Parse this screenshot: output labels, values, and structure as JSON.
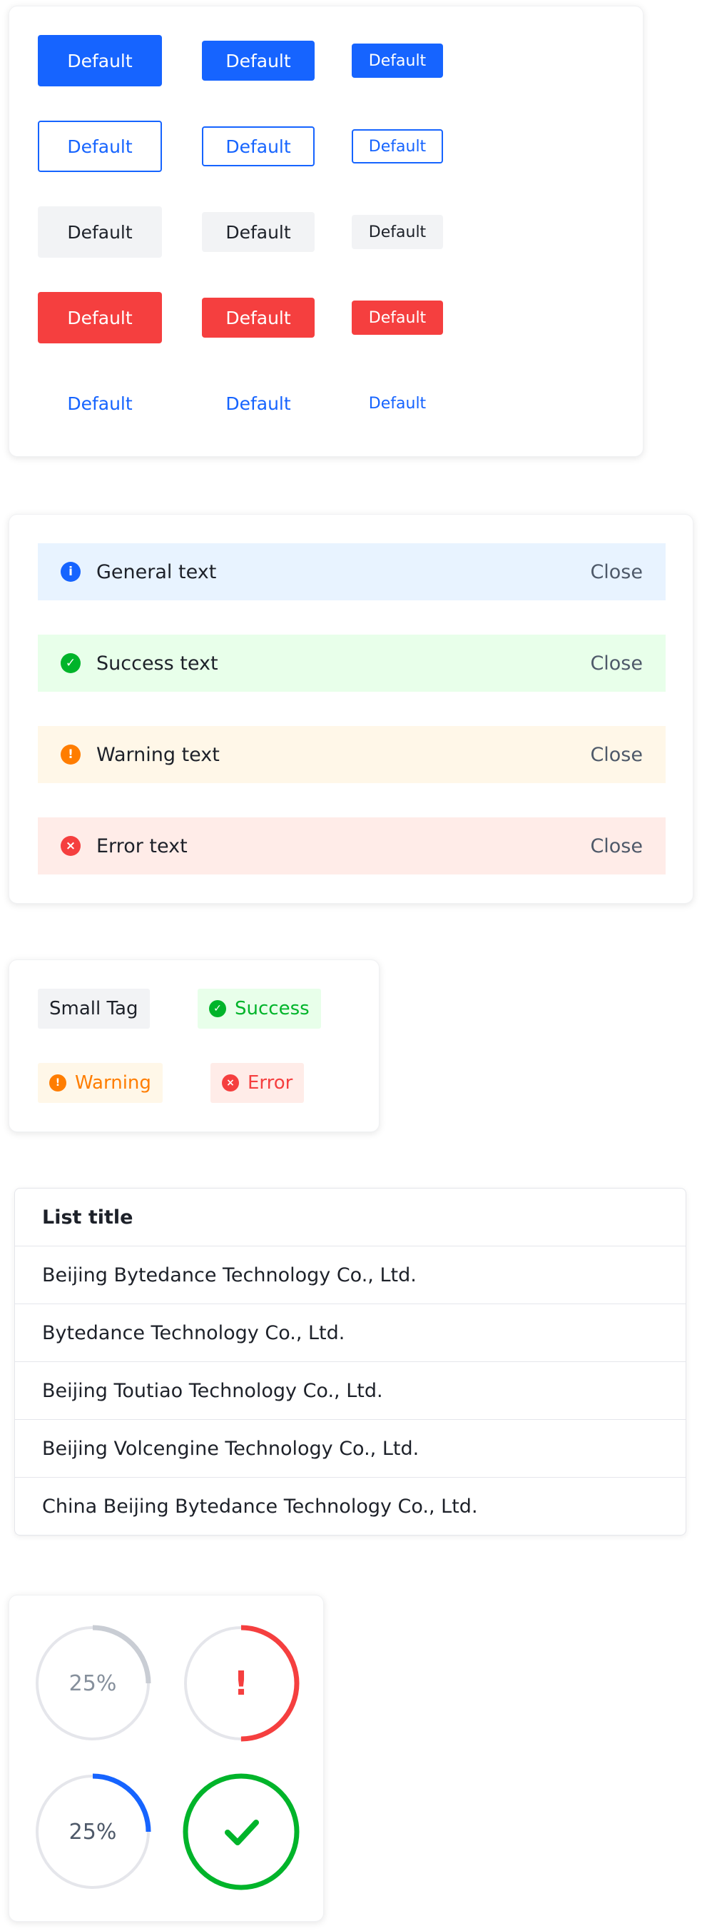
{
  "buttons": {
    "label": "Default",
    "rows": [
      {
        "variant": "primary"
      },
      {
        "variant": "outline"
      },
      {
        "variant": "secondary"
      },
      {
        "variant": "danger"
      },
      {
        "variant": "text"
      }
    ]
  },
  "notices": [
    {
      "type": "info",
      "text": "General text",
      "close": "Close",
      "icon": "info-icon",
      "bg": "#e8f3ff",
      "color": "#1664ff"
    },
    {
      "type": "success",
      "text": "Success text",
      "close": "Close",
      "icon": "check-circle-icon",
      "bg": "#e8ffea",
      "color": "#00b42a"
    },
    {
      "type": "warning",
      "text": "Warning text",
      "close": "Close",
      "icon": "exclamation-circle-icon",
      "bg": "#fff7e8",
      "color": "#ff7d00"
    },
    {
      "type": "error",
      "text": "Error text",
      "close": "Close",
      "icon": "close-circle-icon",
      "bg": "#ffece8",
      "color": "#f53f3f"
    }
  ],
  "tags": [
    {
      "text": "Small Tag",
      "icon": null
    },
    {
      "text": "Success",
      "icon": "check-circle-icon",
      "color": "#00b42a",
      "bg": "#e8ffea"
    },
    {
      "text": "Warning",
      "icon": "exclamation-circle-icon",
      "color": "#ff7d00",
      "bg": "#fff7e8"
    },
    {
      "text": "Error",
      "icon": "close-circle-icon",
      "color": "#f53f3f",
      "bg": "#ffece8"
    }
  ],
  "list": {
    "title": "List title",
    "items": [
      "Beijing Bytedance Technology Co., Ltd.",
      "Bytedance Technology Co., Ltd.",
      "Beijing Toutiao Technology Co., Ltd.",
      "Beijing Volcengine Technology Co., Ltd.",
      "China Beijing Bytedance Technology Co., Ltd."
    ]
  },
  "progress": [
    {
      "label": "25%",
      "percent": 25,
      "color": "#c9cdd4",
      "status": "normal"
    },
    {
      "label": "",
      "percent": 50,
      "color": "#f53f3f",
      "status": "error",
      "icon": "exclamation-icon"
    },
    {
      "label": "25%",
      "percent": 25,
      "color": "#1664ff",
      "status": "active"
    },
    {
      "label": "",
      "percent": 100,
      "color": "#00b42a",
      "status": "success",
      "icon": "check-icon"
    }
  ]
}
